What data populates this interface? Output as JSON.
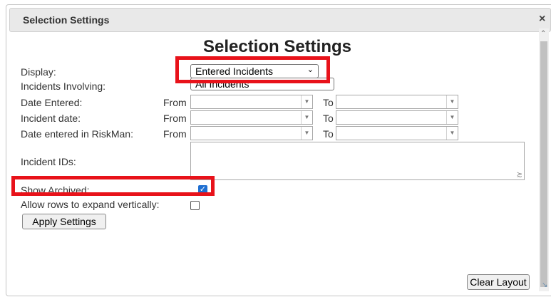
{
  "dialog": {
    "title": "Selection Settings",
    "close_glyph": "×"
  },
  "heading": "Selection Settings",
  "fields": {
    "display": {
      "label": "Display:",
      "value": "Entered Incidents"
    },
    "involving": {
      "label": "Incidents Involving:",
      "value": "All Incidents"
    },
    "date_entered": {
      "label": "Date Entered:",
      "from": "From",
      "to": "To"
    },
    "incident_date": {
      "label": "Incident date:",
      "from": "From",
      "to": "To"
    },
    "date_riskman": {
      "label": "Date entered in RiskMan:",
      "from": "From",
      "to": "To"
    },
    "incident_ids": {
      "label": "Incident IDs:"
    },
    "show_archived": {
      "label": "Show Archived:",
      "checked": true
    },
    "expand_rows": {
      "label": "Allow rows to expand vertically:",
      "checked": false
    }
  },
  "buttons": {
    "apply": "Apply Settings",
    "clear": "Clear Layout"
  },
  "colors": {
    "highlight": "#e8121a",
    "checkbox_on": "#1f6fd1"
  }
}
